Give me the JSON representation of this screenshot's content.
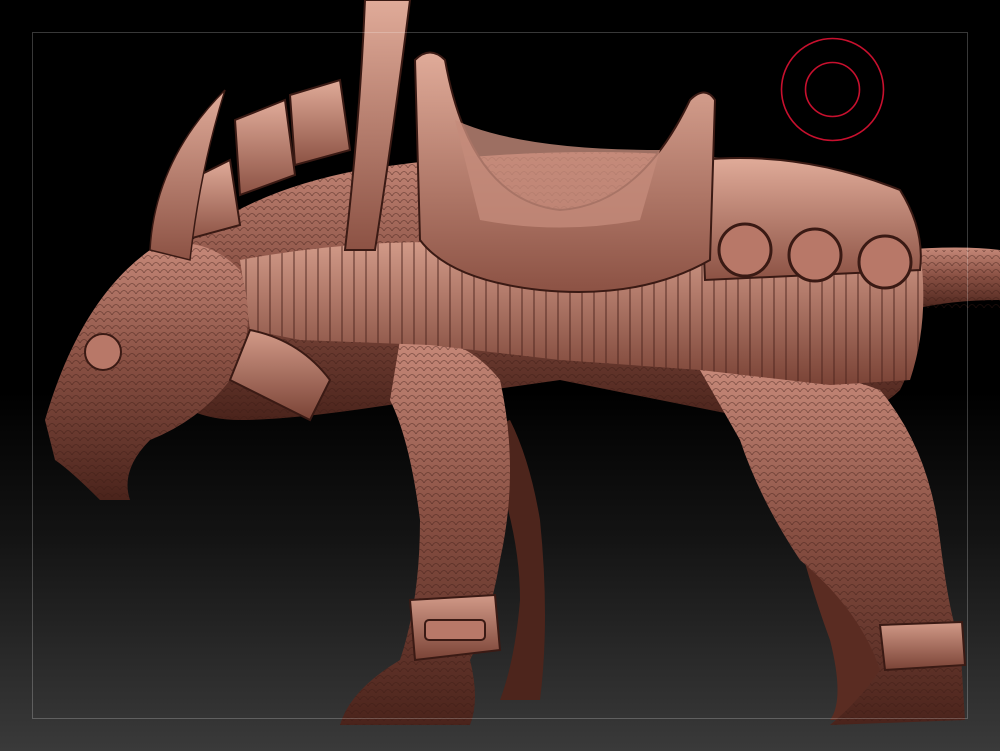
{
  "viewport": {
    "background_top": "#000000",
    "background_bottom": "#3a3a3a",
    "frame_color": "#ffffff"
  },
  "gizmo": {
    "icon": "brush-cursor-circle-icon",
    "color": "#c8102e"
  },
  "model": {
    "icon": "armored-beast-sculpt-icon",
    "material_color": "#8a5144",
    "highlight_color": "#d8a090",
    "shadow_color": "#3a1a14"
  }
}
